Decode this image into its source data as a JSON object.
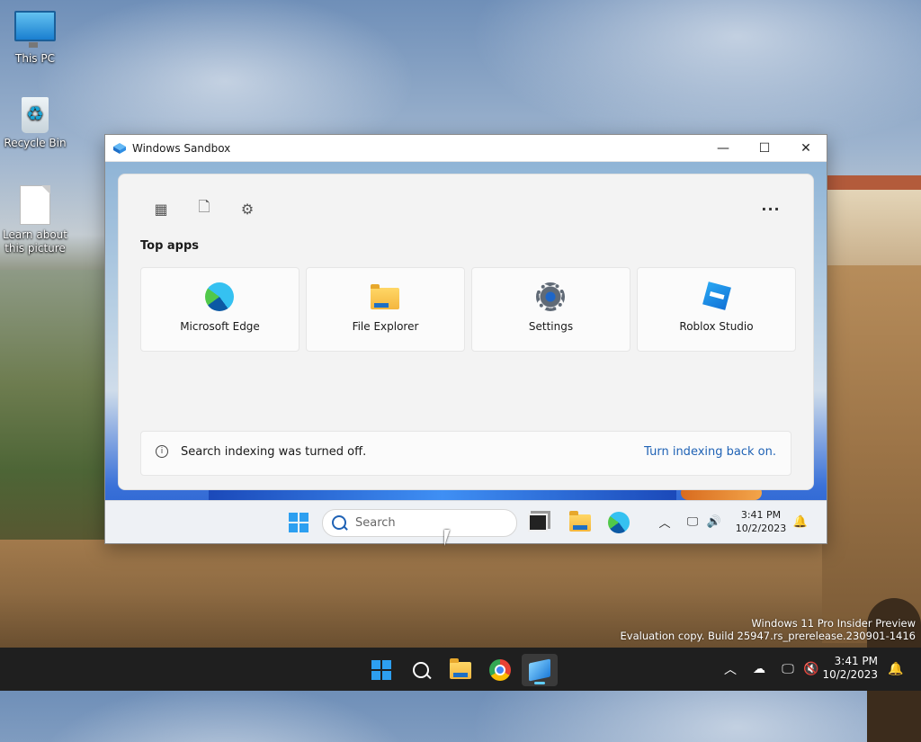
{
  "desktop": {
    "icons": [
      {
        "label": "This PC",
        "icon": "this-pc-icon"
      },
      {
        "label": "Recycle Bin",
        "icon": "recycle-bin-icon"
      },
      {
        "label": "Learn about this picture",
        "icon": "document-icon"
      }
    ]
  },
  "sandbox_window": {
    "title": "Windows Sandbox",
    "minimize": "—",
    "maximize": "☐",
    "close": "✕",
    "panel": {
      "tabs": [
        {
          "icon": "apps-icon",
          "glyph": "▦"
        },
        {
          "icon": "document-icon",
          "glyph": "🗋"
        },
        {
          "icon": "settings-icon",
          "glyph": "⚙"
        }
      ],
      "more_glyph": "···",
      "top_apps_heading": "Top apps",
      "apps": [
        {
          "label": "Microsoft Edge",
          "icon": "edge-icon"
        },
        {
          "label": "File Explorer",
          "icon": "file-explorer-icon"
        },
        {
          "label": "Settings",
          "icon": "settings-gear-icon"
        },
        {
          "label": "Roblox Studio",
          "icon": "roblox-studio-icon"
        }
      ],
      "notice": {
        "info_glyph": "i",
        "text": "Search indexing was turned off.",
        "link": "Turn indexing back on."
      }
    },
    "taskbar": {
      "search_placeholder": "Search",
      "time": "3:41 PM",
      "date": "10/2/2023"
    }
  },
  "watermark": {
    "line1": "Windows 11 Pro Insider Preview",
    "line2": "Evaluation copy. Build 25947.rs_prerelease.230901-1416"
  },
  "taskbar": {
    "time": "3:41 PM",
    "date": "10/2/2023",
    "tray": {
      "chevron": "︿",
      "notification": "🔔"
    }
  }
}
